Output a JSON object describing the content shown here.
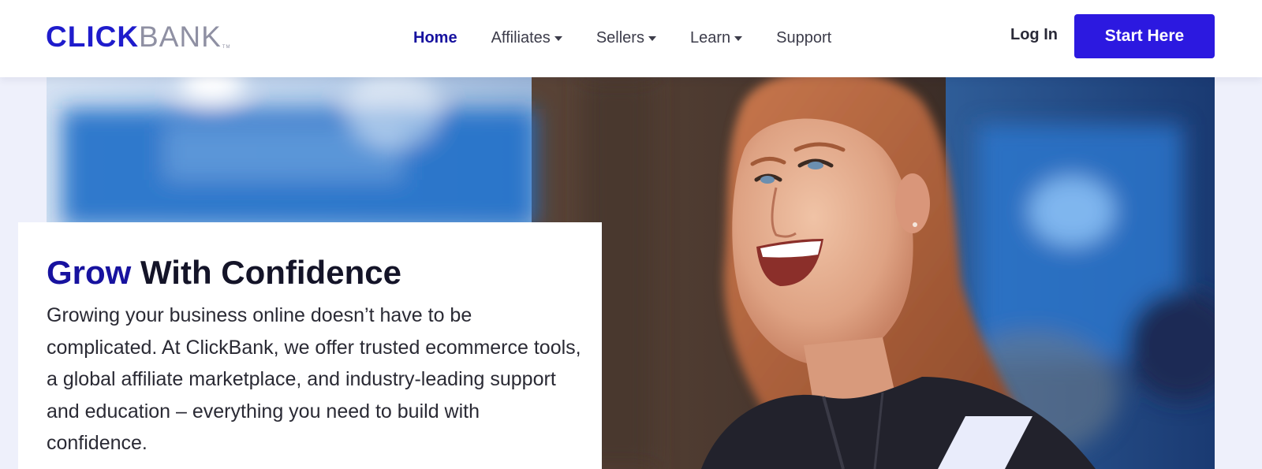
{
  "brand": {
    "logo_primary": "CLICK",
    "logo_secondary": "BANK",
    "logo_tm": "TM",
    "primary_color": "#1f1ccc",
    "secondary_color": "#8f90a3"
  },
  "nav": {
    "items": [
      {
        "label": "Home",
        "active": true,
        "dropdown": false
      },
      {
        "label": "Affiliates",
        "active": false,
        "dropdown": true
      },
      {
        "label": "Sellers",
        "active": false,
        "dropdown": true
      },
      {
        "label": "Learn",
        "active": false,
        "dropdown": true
      },
      {
        "label": "Support",
        "active": false,
        "dropdown": false
      }
    ],
    "login_label": "Log In",
    "cta_label": "Start Here",
    "cta_color": "#2c19e0"
  },
  "hero": {
    "headline_accent": "Grow",
    "headline_rest": " With Confidence",
    "body": "Growing your business online doesn’t have to be complicated. At ClickBank, we offer trusted ecommerce tools, a global affiliate marketplace, and industry-leading support and education – everything you need to build with confidence.",
    "image": "smiling-woman-photo"
  }
}
